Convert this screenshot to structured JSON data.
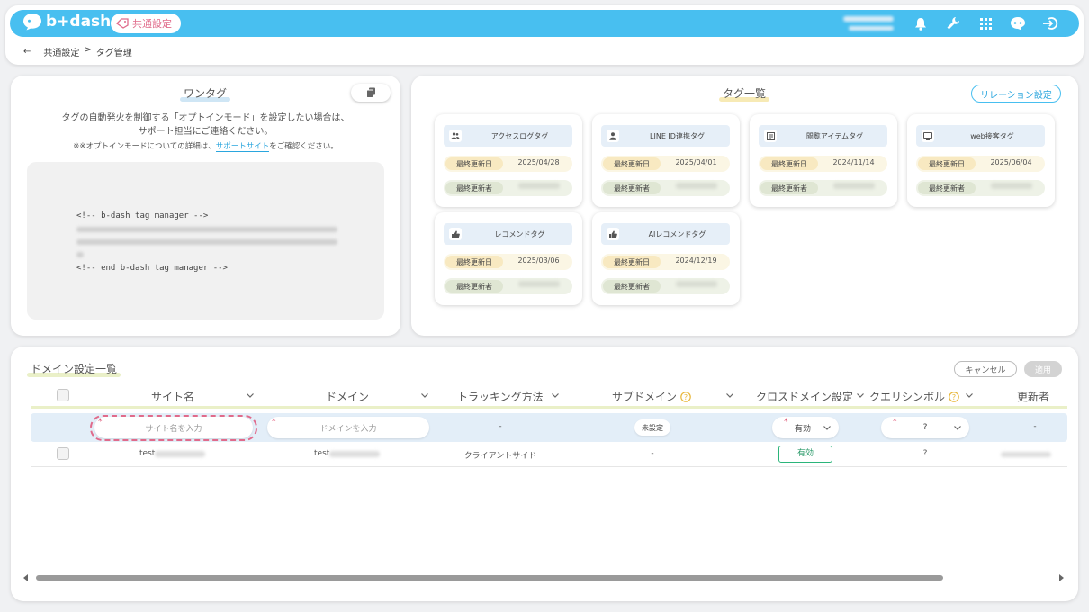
{
  "header": {
    "logo_text": "b+dash",
    "shared_badge": "共通設定",
    "icons": [
      "bell-icon",
      "wrench-icon",
      "apps-grid-icon",
      "chat-bot-icon",
      "logout-icon"
    ],
    "colors": {
      "brand": "#48bff0",
      "accent_pink": "#e06b8b"
    }
  },
  "breadcrumb": {
    "back": "←",
    "parent": "共通設定",
    "separator": ">",
    "current": "タグ管理"
  },
  "onetag": {
    "title": "ワンタグ",
    "desc_line1": "タグの自動発火を制御する「オプトインモード」を設定したい場合は、",
    "desc_line2": "サポート担当にご連絡ください。",
    "note_prefix": "※※オプトインモードについての詳細は、",
    "note_link": "サポートサイト",
    "note_suffix": "をご確認ください。",
    "code_start": "<!-- b-dash tag manager -->",
    "code_end": "<!-- end b-dash tag manager -->"
  },
  "taglist": {
    "title": "タグ一覧",
    "relation_button": "リレーション設定",
    "date_label": "最終更新日",
    "author_label": "最終更新者",
    "tags": [
      {
        "name": "アクセスログタグ",
        "icon": "users-icon",
        "date": "2025/04/28"
      },
      {
        "name": "LINE ID連携タグ",
        "icon": "person-icon",
        "date": "2025/04/01"
      },
      {
        "name": "閲覧アイテムタグ",
        "icon": "document-icon",
        "date": "2024/11/14"
      },
      {
        "name": "web接客タグ",
        "icon": "monitor-icon",
        "date": "2025/06/04"
      },
      {
        "name": "レコメンドタグ",
        "icon": "thumbs-up-icon",
        "date": "2025/03/06"
      },
      {
        "name": "AIレコメンドタグ",
        "icon": "thumbs-up-icon",
        "date": "2024/12/19"
      }
    ]
  },
  "domain": {
    "title": "ドメイン設定一覧",
    "cancel": "キャンセル",
    "apply": "適用",
    "columns": {
      "site_name": "サイト名",
      "domain": "ドメイン",
      "tracking": "トラッキング方法",
      "subdomain": "サブドメイン",
      "cross_domain": "クロスドメイン設定",
      "query_symbol": "クエリシンボル",
      "updater": "更新者"
    },
    "input_row": {
      "required_mark": "*",
      "site_placeholder": "サイト名を入力",
      "domain_placeholder": "ドメインを入力",
      "tracking": "-",
      "subdomain": "未設定",
      "cross_domain": "有効",
      "query_symbol": "?",
      "updater": "-"
    },
    "rows": [
      {
        "site": "test",
        "domain": "test",
        "tracking": "クライアントサイド",
        "subdomain": "-",
        "cross_domain": "有効",
        "query_symbol": "?"
      }
    ]
  }
}
